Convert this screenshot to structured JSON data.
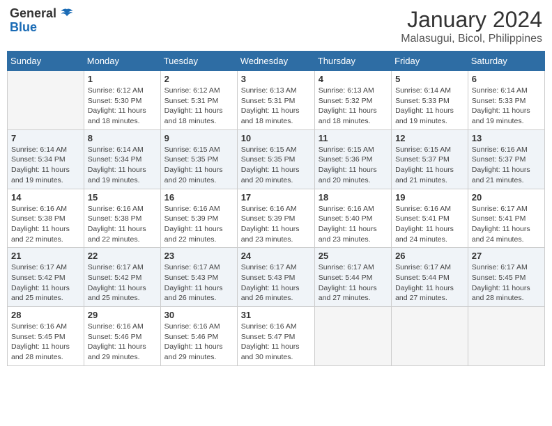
{
  "header": {
    "logo_general": "General",
    "logo_blue": "Blue",
    "month_year": "January 2024",
    "location": "Malasugui, Bicol, Philippines"
  },
  "weekdays": [
    "Sunday",
    "Monday",
    "Tuesday",
    "Wednesday",
    "Thursday",
    "Friday",
    "Saturday"
  ],
  "weeks": [
    [
      {
        "day": "",
        "info": ""
      },
      {
        "day": "1",
        "info": "Sunrise: 6:12 AM\nSunset: 5:30 PM\nDaylight: 11 hours\nand 18 minutes."
      },
      {
        "day": "2",
        "info": "Sunrise: 6:12 AM\nSunset: 5:31 PM\nDaylight: 11 hours\nand 18 minutes."
      },
      {
        "day": "3",
        "info": "Sunrise: 6:13 AM\nSunset: 5:31 PM\nDaylight: 11 hours\nand 18 minutes."
      },
      {
        "day": "4",
        "info": "Sunrise: 6:13 AM\nSunset: 5:32 PM\nDaylight: 11 hours\nand 18 minutes."
      },
      {
        "day": "5",
        "info": "Sunrise: 6:14 AM\nSunset: 5:33 PM\nDaylight: 11 hours\nand 19 minutes."
      },
      {
        "day": "6",
        "info": "Sunrise: 6:14 AM\nSunset: 5:33 PM\nDaylight: 11 hours\nand 19 minutes."
      }
    ],
    [
      {
        "day": "7",
        "info": "Sunrise: 6:14 AM\nSunset: 5:34 PM\nDaylight: 11 hours\nand 19 minutes."
      },
      {
        "day": "8",
        "info": "Sunrise: 6:14 AM\nSunset: 5:34 PM\nDaylight: 11 hours\nand 19 minutes."
      },
      {
        "day": "9",
        "info": "Sunrise: 6:15 AM\nSunset: 5:35 PM\nDaylight: 11 hours\nand 20 minutes."
      },
      {
        "day": "10",
        "info": "Sunrise: 6:15 AM\nSunset: 5:35 PM\nDaylight: 11 hours\nand 20 minutes."
      },
      {
        "day": "11",
        "info": "Sunrise: 6:15 AM\nSunset: 5:36 PM\nDaylight: 11 hours\nand 20 minutes."
      },
      {
        "day": "12",
        "info": "Sunrise: 6:15 AM\nSunset: 5:37 PM\nDaylight: 11 hours\nand 21 minutes."
      },
      {
        "day": "13",
        "info": "Sunrise: 6:16 AM\nSunset: 5:37 PM\nDaylight: 11 hours\nand 21 minutes."
      }
    ],
    [
      {
        "day": "14",
        "info": "Sunrise: 6:16 AM\nSunset: 5:38 PM\nDaylight: 11 hours\nand 22 minutes."
      },
      {
        "day": "15",
        "info": "Sunrise: 6:16 AM\nSunset: 5:38 PM\nDaylight: 11 hours\nand 22 minutes."
      },
      {
        "day": "16",
        "info": "Sunrise: 6:16 AM\nSunset: 5:39 PM\nDaylight: 11 hours\nand 22 minutes."
      },
      {
        "day": "17",
        "info": "Sunrise: 6:16 AM\nSunset: 5:39 PM\nDaylight: 11 hours\nand 23 minutes."
      },
      {
        "day": "18",
        "info": "Sunrise: 6:16 AM\nSunset: 5:40 PM\nDaylight: 11 hours\nand 23 minutes."
      },
      {
        "day": "19",
        "info": "Sunrise: 6:16 AM\nSunset: 5:41 PM\nDaylight: 11 hours\nand 24 minutes."
      },
      {
        "day": "20",
        "info": "Sunrise: 6:17 AM\nSunset: 5:41 PM\nDaylight: 11 hours\nand 24 minutes."
      }
    ],
    [
      {
        "day": "21",
        "info": "Sunrise: 6:17 AM\nSunset: 5:42 PM\nDaylight: 11 hours\nand 25 minutes."
      },
      {
        "day": "22",
        "info": "Sunrise: 6:17 AM\nSunset: 5:42 PM\nDaylight: 11 hours\nand 25 minutes."
      },
      {
        "day": "23",
        "info": "Sunrise: 6:17 AM\nSunset: 5:43 PM\nDaylight: 11 hours\nand 26 minutes."
      },
      {
        "day": "24",
        "info": "Sunrise: 6:17 AM\nSunset: 5:43 PM\nDaylight: 11 hours\nand 26 minutes."
      },
      {
        "day": "25",
        "info": "Sunrise: 6:17 AM\nSunset: 5:44 PM\nDaylight: 11 hours\nand 27 minutes."
      },
      {
        "day": "26",
        "info": "Sunrise: 6:17 AM\nSunset: 5:44 PM\nDaylight: 11 hours\nand 27 minutes."
      },
      {
        "day": "27",
        "info": "Sunrise: 6:17 AM\nSunset: 5:45 PM\nDaylight: 11 hours\nand 28 minutes."
      }
    ],
    [
      {
        "day": "28",
        "info": "Sunrise: 6:16 AM\nSunset: 5:45 PM\nDaylight: 11 hours\nand 28 minutes."
      },
      {
        "day": "29",
        "info": "Sunrise: 6:16 AM\nSunset: 5:46 PM\nDaylight: 11 hours\nand 29 minutes."
      },
      {
        "day": "30",
        "info": "Sunrise: 6:16 AM\nSunset: 5:46 PM\nDaylight: 11 hours\nand 29 minutes."
      },
      {
        "day": "31",
        "info": "Sunrise: 6:16 AM\nSunset: 5:47 PM\nDaylight: 11 hours\nand 30 minutes."
      },
      {
        "day": "",
        "info": ""
      },
      {
        "day": "",
        "info": ""
      },
      {
        "day": "",
        "info": ""
      }
    ]
  ]
}
